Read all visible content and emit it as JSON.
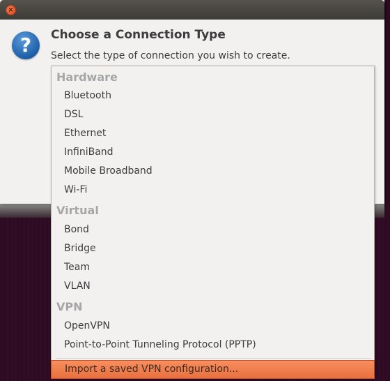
{
  "window": {
    "close_label": "×"
  },
  "dialog": {
    "icon": "question-icon",
    "title": "Choose a Connection Type",
    "subtitle": "Select the type of connection you wish to create."
  },
  "menu": {
    "groups": [
      {
        "header": "Hardware",
        "items": [
          "Bluetooth",
          "DSL",
          "Ethernet",
          "InfiniBand",
          "Mobile Broadband",
          "Wi-Fi"
        ]
      },
      {
        "header": "Virtual",
        "items": [
          "Bond",
          "Bridge",
          "Team",
          "VLAN"
        ]
      },
      {
        "header": "VPN",
        "items": [
          "OpenVPN",
          "Point-to-Point Tunneling Protocol (PPTP)"
        ]
      }
    ],
    "import_item": "Import a saved VPN configuration...",
    "selected": "Import a saved VPN configuration..."
  },
  "colors": {
    "accent": "#f07746",
    "background": "#2c0a22",
    "group_header": "#a6a6a6"
  }
}
